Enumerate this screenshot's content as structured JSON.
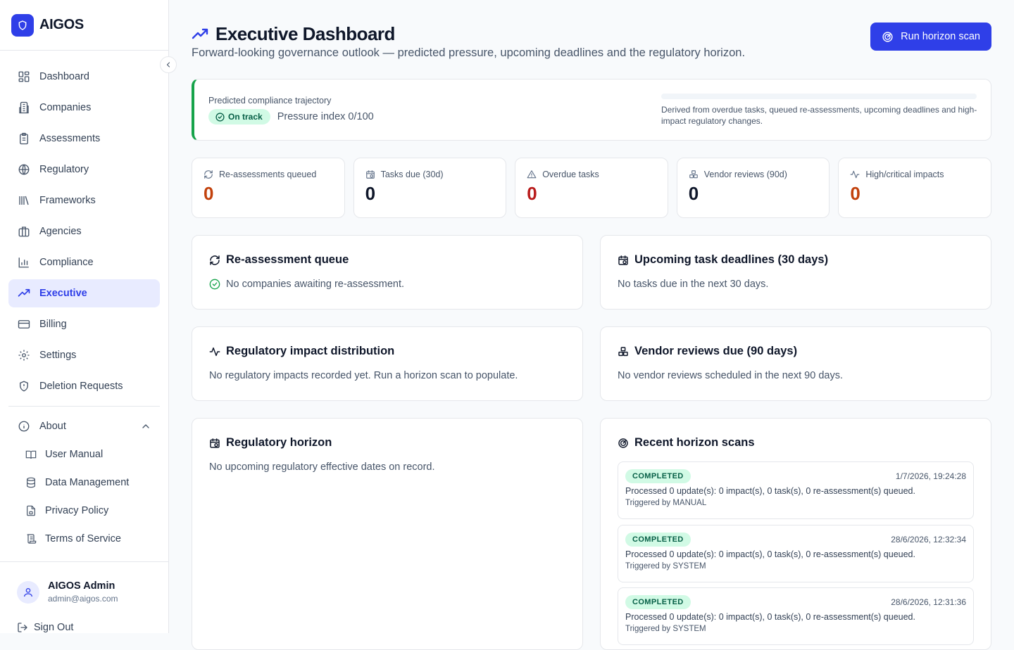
{
  "app": {
    "name": "AIGOS"
  },
  "sidebar": {
    "items": [
      {
        "label": "Dashboard",
        "icon": "layout-grid-icon"
      },
      {
        "label": "Companies",
        "icon": "building-icon"
      },
      {
        "label": "Assessments",
        "icon": "clipboard-icon"
      },
      {
        "label": "Regulatory",
        "icon": "globe-icon"
      },
      {
        "label": "Frameworks",
        "icon": "library-icon"
      },
      {
        "label": "Agencies",
        "icon": "briefcase-icon"
      },
      {
        "label": "Compliance",
        "icon": "bar-chart-icon"
      },
      {
        "label": "Executive",
        "icon": "trending-up-icon",
        "active": true
      },
      {
        "label": "Billing",
        "icon": "credit-card-icon"
      },
      {
        "label": "Settings",
        "icon": "gear-icon"
      },
      {
        "label": "Deletion Requests",
        "icon": "shield-icon"
      }
    ],
    "about": {
      "label": "About",
      "children": [
        {
          "label": "User Manual",
          "icon": "book-open-icon"
        },
        {
          "label": "Data Management",
          "icon": "database-icon"
        },
        {
          "label": "Privacy Policy",
          "icon": "file-lock-icon"
        },
        {
          "label": "Terms of Service",
          "icon": "scroll-icon"
        }
      ]
    },
    "user": {
      "name": "AIGOS Admin",
      "email": "admin@aigos.com"
    },
    "sign_out": "Sign Out"
  },
  "header": {
    "title": "Executive Dashboard",
    "subtitle": "Forward-looking governance outlook — predicted pressure, upcoming deadlines and the regulatory horizon.",
    "scan_button": "Run horizon scan"
  },
  "trajectory": {
    "label": "Predicted compliance trajectory",
    "status": "On track",
    "pressure": "Pressure index 0/100",
    "pressure_value": 0,
    "note": "Derived from overdue tasks, queued re-assessments, upcoming deadlines and high-impact regulatory changes.",
    "status_color": "#16a34a"
  },
  "stats": [
    {
      "label": "Re-assessments queued",
      "value": "0",
      "color": "#c2410c",
      "icon": "refresh-icon"
    },
    {
      "label": "Tasks due (30d)",
      "value": "0",
      "color": "#0f172a",
      "icon": "calendar-clock-icon"
    },
    {
      "label": "Overdue tasks",
      "value": "0",
      "color": "#b91c1c",
      "icon": "alert-triangle-icon"
    },
    {
      "label": "Vendor reviews (90d)",
      "value": "0",
      "color": "#0f172a",
      "icon": "boxes-icon"
    },
    {
      "label": "High/critical impacts",
      "value": "0",
      "color": "#c2410c",
      "icon": "activity-icon"
    }
  ],
  "cards": {
    "reassessment": {
      "title": "Re-assessment queue",
      "body": "No companies awaiting re-assessment."
    },
    "deadlines": {
      "title": "Upcoming task deadlines (30 days)",
      "body": "No tasks due in the next 30 days."
    },
    "impact": {
      "title": "Regulatory impact distribution",
      "body": "No regulatory impacts recorded yet. Run a horizon scan to populate."
    },
    "vendor": {
      "title": "Vendor reviews due (90 days)",
      "body": "No vendor reviews scheduled in the next 90 days."
    },
    "horizon": {
      "title": "Regulatory horizon",
      "body": "No upcoming regulatory effective dates on record."
    },
    "scans": {
      "title": "Recent horizon scans",
      "items": [
        {
          "status": "COMPLETED",
          "time": "1/7/2026, 19:24:28",
          "text": "Processed 0 update(s): 0 impact(s), 0 task(s), 0 re-assessment(s) queued.",
          "trigger": "Triggered by MANUAL"
        },
        {
          "status": "COMPLETED",
          "time": "28/6/2026, 12:32:34",
          "text": "Processed 0 update(s): 0 impact(s), 0 task(s), 0 re-assessment(s) queued.",
          "trigger": "Triggered by SYSTEM"
        },
        {
          "status": "COMPLETED",
          "time": "28/6/2026, 12:31:36",
          "text": "Processed 0 update(s): 0 impact(s), 0 task(s), 0 re-assessment(s) queued.",
          "trigger": "Triggered by SYSTEM"
        }
      ]
    }
  },
  "colors": {
    "accent": "#2f3fe8",
    "success": "#16a34a",
    "warning": "#c2410c",
    "danger": "#b91c1c"
  }
}
